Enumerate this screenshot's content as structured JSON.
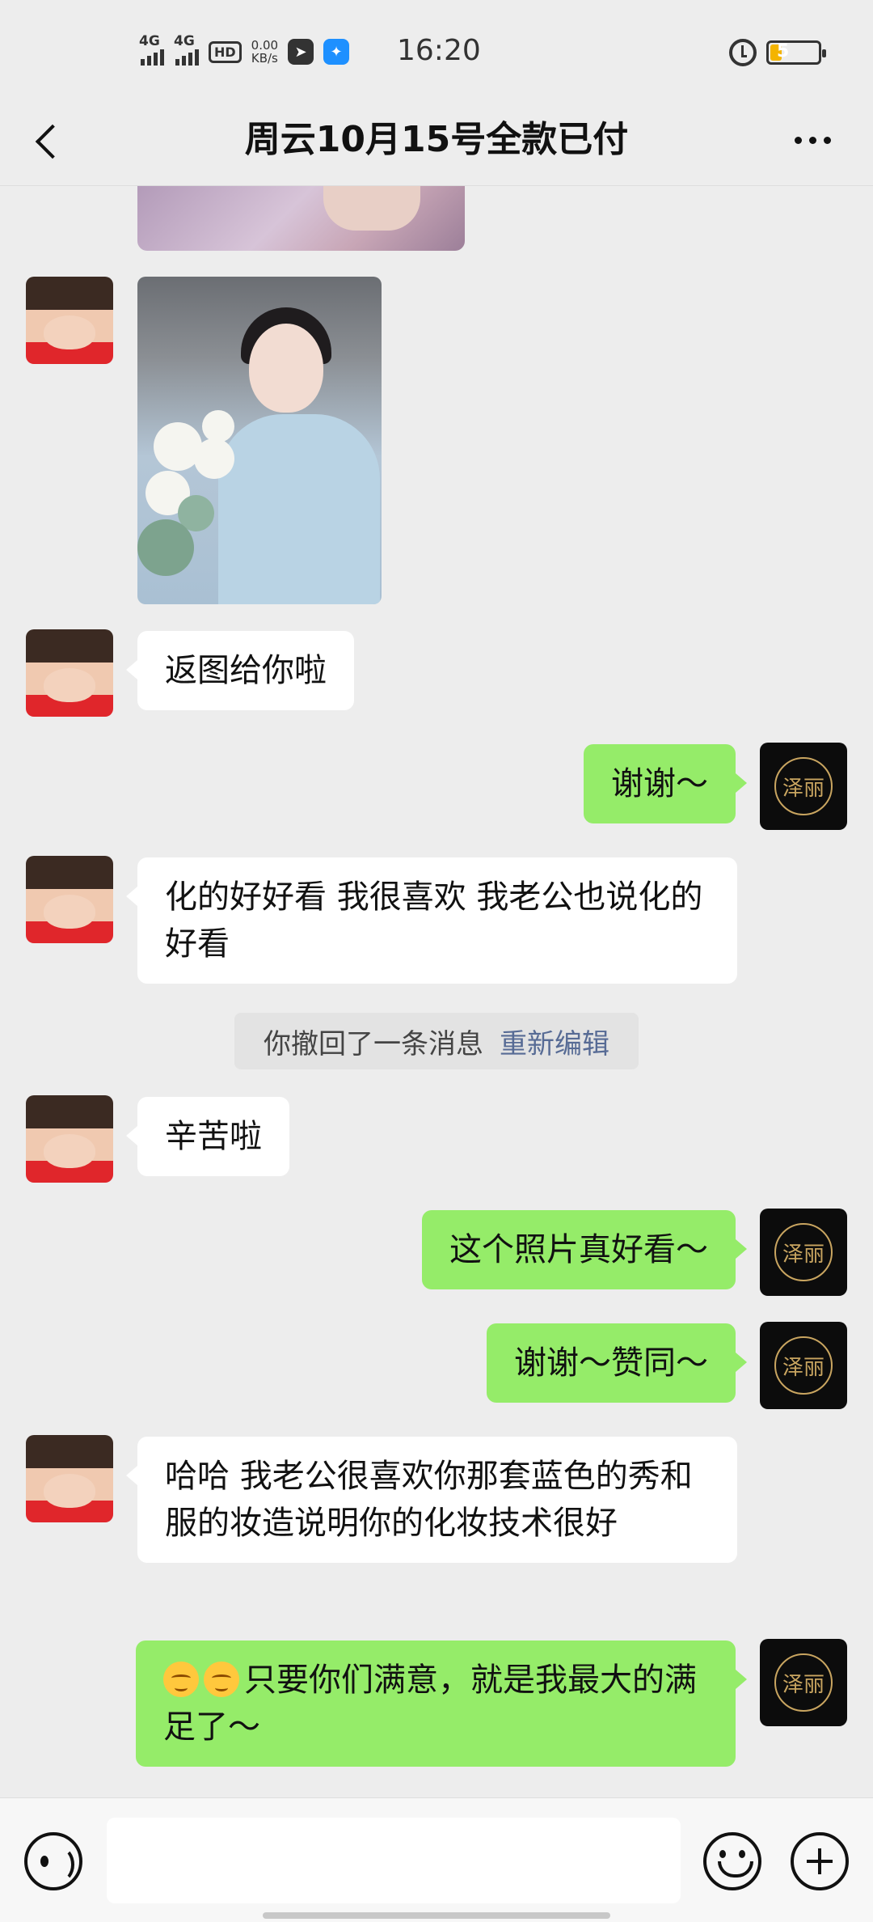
{
  "status_bar": {
    "signal_1": "4G",
    "signal_2": "4G",
    "hd": "HD",
    "net_speed_value": "0.00",
    "net_speed_unit": "KB/s",
    "time": "16:20",
    "battery_level": "5",
    "battery_fraction": 0.08
  },
  "header": {
    "title": "周云10月15号全款已付"
  },
  "messages": [
    {
      "sender": "them",
      "type": "image"
    },
    {
      "sender": "them",
      "type": "image"
    },
    {
      "sender": "them",
      "type": "text",
      "text": "返图给你啦"
    },
    {
      "sender": "me",
      "type": "text",
      "text": "谢谢～"
    },
    {
      "sender": "them",
      "type": "text",
      "text": "化的好好看 我很喜欢 我老公也说化的好看"
    },
    {
      "sender": "system",
      "type": "recall",
      "text": "你撤回了一条消息",
      "action": "重新编辑"
    },
    {
      "sender": "them",
      "type": "text",
      "text": "辛苦啦"
    },
    {
      "sender": "me",
      "type": "text",
      "text": "这个照片真好看～"
    },
    {
      "sender": "me",
      "type": "text",
      "text": "谢谢～赞同～"
    },
    {
      "sender": "them",
      "type": "text",
      "text": "哈哈 我老公很喜欢你那套蓝色的秀和服的妆造说明你的化妆技术很好"
    },
    {
      "sender": "me",
      "type": "text",
      "emoji": [
        "smile-emoji",
        "smile-emoji"
      ],
      "text": "只要你们满意，就是我最大的满足了～"
    }
  ],
  "avatars": {
    "me_logo_text": "泽丽"
  },
  "input_bar": {
    "placeholder": ""
  },
  "icons": {
    "back": "chevron-left-icon",
    "more": "more-dots-icon",
    "voice": "voice-icon",
    "emoji": "emoji-icon",
    "plus": "plus-icon"
  },
  "colors": {
    "background": "#ededed",
    "outgoing_bubble": "#95ec69",
    "incoming_bubble": "#ffffff",
    "link": "#576b95"
  }
}
